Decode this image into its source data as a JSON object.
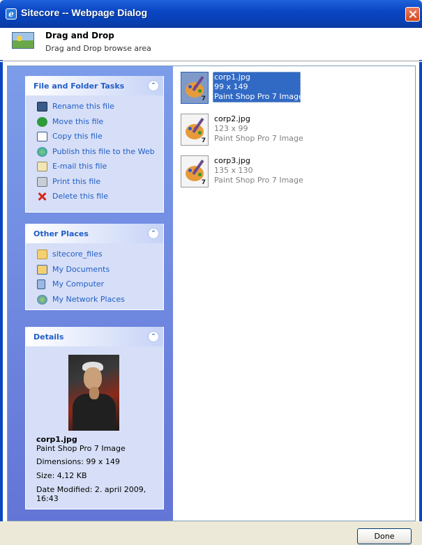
{
  "window": {
    "title": "Sitecore -- Webpage Dialog",
    "close_icon": "close-icon",
    "app_icon": "ie-icon"
  },
  "header": {
    "title": "Drag and Drop",
    "subtitle": "Drag and Drop browse area",
    "icon": "image-icon"
  },
  "tasks": {
    "title": "File and Folder Tasks",
    "items": [
      {
        "label": "Rename this file",
        "icon": "rename-icon"
      },
      {
        "label": "Move this file",
        "icon": "move-icon"
      },
      {
        "label": "Copy this file",
        "icon": "copy-icon"
      },
      {
        "label": "Publish this file to the Web",
        "icon": "publish-web-icon"
      },
      {
        "label": "E-mail this file",
        "icon": "email-icon"
      },
      {
        "label": "Print this file",
        "icon": "print-icon"
      },
      {
        "label": "Delete this file",
        "icon": "delete-icon"
      }
    ]
  },
  "places": {
    "title": "Other Places",
    "items": [
      {
        "label": "sitecore_files",
        "icon": "folder-icon"
      },
      {
        "label": "My Documents",
        "icon": "my-documents-icon"
      },
      {
        "label": "My Computer",
        "icon": "my-computer-icon"
      },
      {
        "label": "My Network Places",
        "icon": "network-places-icon"
      }
    ]
  },
  "details": {
    "title": "Details",
    "filename": "corp1.jpg",
    "type": "Paint Shop Pro 7 Image",
    "dimensions": "Dimensions: 99 x 149",
    "size": "Size: 4,12 KB",
    "modified_line1": "Date Modified: 2. april 2009,",
    "modified_line2": "16:43"
  },
  "files": [
    {
      "name": "corp1.jpg",
      "dims": "99 x 149",
      "type": "Paint Shop Pro 7 Image",
      "selected": true,
      "badge": "7"
    },
    {
      "name": "corp2.jpg",
      "dims": "123 x 99",
      "type": "Paint Shop Pro 7 Image",
      "selected": false,
      "badge": "7"
    },
    {
      "name": "corp3.jpg",
      "dims": "135 x 130",
      "type": "Paint Shop Pro 7 Image",
      "selected": false,
      "badge": "7"
    }
  ],
  "buttons": {
    "done": "Done"
  },
  "colors": {
    "titlebar": "#0a45c4",
    "task_pane": "#6375d6",
    "link": "#215dc6",
    "selection": "#316ac5"
  }
}
